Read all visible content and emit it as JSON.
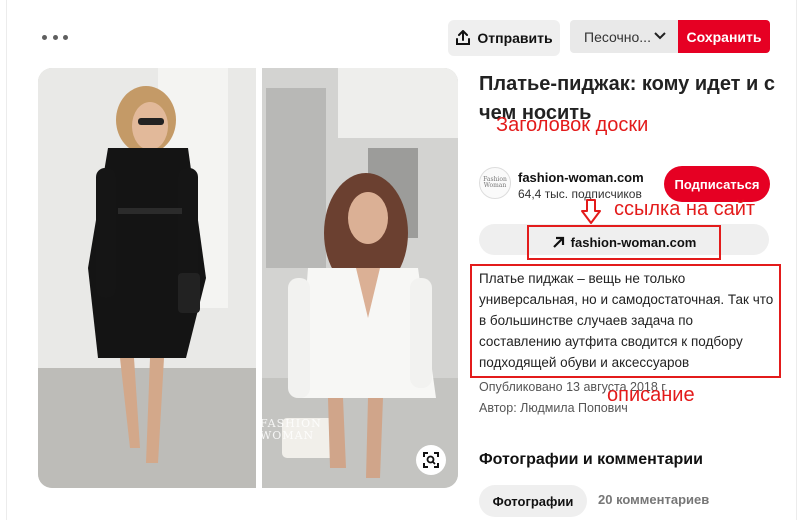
{
  "toolbar": {
    "share_label": "Отправить",
    "board_select": "Песочно...",
    "save_label": "Сохранить"
  },
  "pin": {
    "title": "Платье-пиджак: кому идет и с чем носить",
    "watermark_brand": "FASHION",
    "watermark_sub": "WOMAN"
  },
  "author": {
    "avatar_line1": "Fashion",
    "avatar_line2": "Woman",
    "name": "fashion-woman.com",
    "followers": "64,4 тыс. подписчиков",
    "follow_label": "Подписаться"
  },
  "link": {
    "label": "fashion-woman.com"
  },
  "description": "Платье пиджак – вещь не только универсальная, но и самодостаточная. Так что в большинстве случаев задача по составлению аутфита сводится к подбору подходящей обуви и аксессуаров",
  "meta": {
    "published": "Опубликовано 13 августа 2018 г.",
    "author": "Автор: Людмила Попович"
  },
  "comments": {
    "section_title": "Фотографии и комментарии",
    "tab_photos": "Фотографии",
    "tab_comments": "20 комментариев"
  },
  "annotations": {
    "board_title": "Заголовок доски",
    "site_link": "ссылка на сайт",
    "description": "описание"
  },
  "colors": {
    "accent": "#e60023",
    "annotation": "#e31b1b"
  },
  "icons": [
    "more-icon",
    "share-icon",
    "chevron-down-icon",
    "arrow-up-right-icon",
    "lens-icon",
    "down-arrow-icon"
  ]
}
